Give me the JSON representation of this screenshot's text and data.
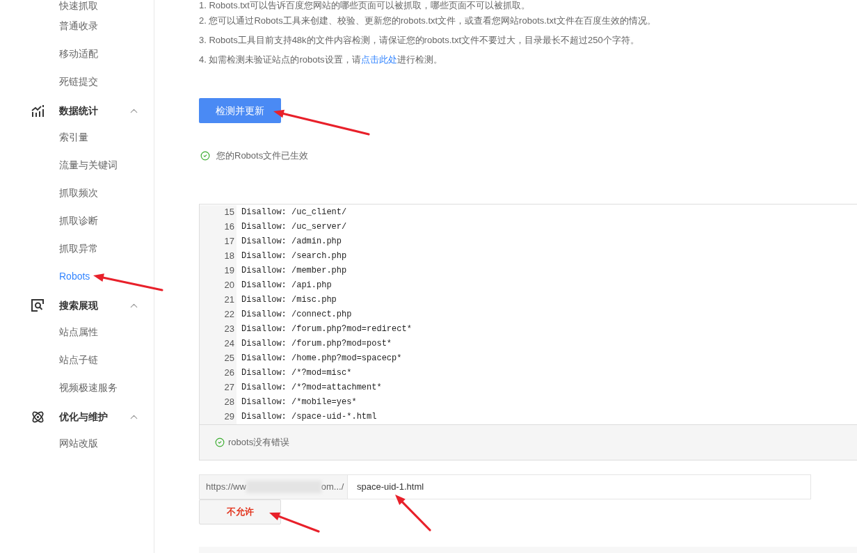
{
  "sidebar": {
    "items": [
      {
        "label": "快速抓取",
        "selected": false
      },
      {
        "label": "普通收录",
        "selected": false
      },
      {
        "label": "移动适配",
        "selected": false
      },
      {
        "label": "死链提交",
        "selected": false
      }
    ],
    "sections": [
      {
        "label": "数据统计",
        "expanded": true,
        "children": [
          {
            "label": "索引量",
            "selected": false
          },
          {
            "label": "流量与关键词",
            "selected": false
          },
          {
            "label": "抓取频次",
            "selected": false
          },
          {
            "label": "抓取诊断",
            "selected": false
          },
          {
            "label": "抓取异常",
            "selected": false
          },
          {
            "label": "Robots",
            "selected": true
          }
        ]
      },
      {
        "label": "搜索展现",
        "expanded": true,
        "children": [
          {
            "label": "站点属性",
            "selected": false
          },
          {
            "label": "站点子链",
            "selected": false
          },
          {
            "label": "视频极速服务",
            "selected": false
          }
        ]
      },
      {
        "label": "优化与维护",
        "expanded": true,
        "children": [
          {
            "label": "网站改版",
            "selected": false
          }
        ]
      }
    ]
  },
  "notes": [
    {
      "text": "1. Robots.txt可以告诉百度您网站的哪些页面可以被抓取，哪些页面不可以被抓取。"
    },
    {
      "text": "2. 您可以通过Robots工具来创建、校验、更新您的robots.txt文件，或查看您网站robots.txt文件在百度生效的情况。"
    },
    {
      "text": "3. Robots工具目前支持48k的文件内容检测，请保证您的robots.txt文件不要过大，目录最长不超过250个字符。"
    },
    {
      "text": "4. 如需检测未验证站点的robots设置，请",
      "link": "点击此处",
      "text_after": "进行检测。"
    }
  ],
  "check_button": {
    "label": "检测并更新"
  },
  "status": {
    "text": "您的Robots文件已生效"
  },
  "editor": {
    "lines": [
      {
        "number": "15",
        "text": "Disallow: /uc_client/"
      },
      {
        "number": "16",
        "text": "Disallow: /uc_server/"
      },
      {
        "number": "17",
        "text": "Disallow: /admin.php"
      },
      {
        "number": "18",
        "text": "Disallow: /search.php"
      },
      {
        "number": "19",
        "text": "Disallow: /member.php"
      },
      {
        "number": "20",
        "text": "Disallow: /api.php"
      },
      {
        "number": "21",
        "text": "Disallow: /misc.php"
      },
      {
        "number": "22",
        "text": "Disallow: /connect.php"
      },
      {
        "number": "23",
        "text": "Disallow: /forum.php?mod=redirect*"
      },
      {
        "number": "24",
        "text": "Disallow: /forum.php?mod=post*"
      },
      {
        "number": "25",
        "text": "Disallow: /home.php?mod=spacecp*"
      },
      {
        "number": "26",
        "text": "Disallow: /*?mod=misc*"
      },
      {
        "number": "27",
        "text": "Disallow: /*?mod=attachment*"
      },
      {
        "number": "28",
        "text": "Disallow: /*mobile=yes*"
      },
      {
        "number": "29",
        "text": "Disallow: /space-uid-*.html"
      }
    ],
    "result": "robots没有错误"
  },
  "url_test": {
    "prefix_start": "https://ww",
    "prefix_end": "om.../",
    "path": "space-uid-1.html",
    "verdict_button": "不允许"
  }
}
